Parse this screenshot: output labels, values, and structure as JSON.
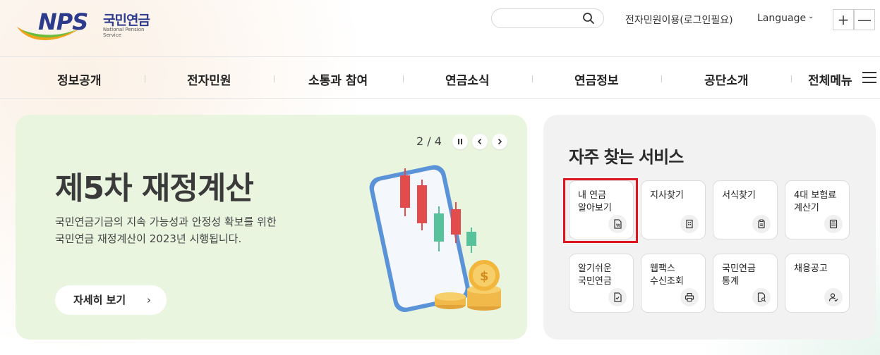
{
  "header": {
    "logo": {
      "brand": "NPS",
      "name_ko": "국민연금",
      "name_en": "National Pension Service"
    },
    "search": {
      "placeholder": ""
    },
    "util_link": "전자민원이용(로그인필요)",
    "language": "Language",
    "zoom_in": "+",
    "zoom_out": "—"
  },
  "nav": {
    "items": [
      "정보공개",
      "전자민원",
      "소통과 참여",
      "연금소식",
      "연금정보",
      "공단소개",
      "전체메뉴"
    ]
  },
  "hero": {
    "pager": "2 / 4",
    "title": "제5차 재정계산",
    "desc_line1": "국민연금기금의 지속 가능성과 안정성 확보를 위한",
    "desc_line2": "국민연금 재정계산이 2023년 시행됩니다.",
    "button": "자세히 보기"
  },
  "services": {
    "title": "자주 찾는 서비스",
    "tiles": [
      {
        "label": "내 연금\n알아보기",
        "icon": "document-won-icon"
      },
      {
        "label": "지사찾기",
        "icon": "building-icon"
      },
      {
        "label": "서식찾기",
        "icon": "clipboard-icon"
      },
      {
        "label": "4대 보험료\n계산기",
        "icon": "calculator-icon"
      },
      {
        "label": "알기쉬운\n국민연금",
        "icon": "document-check-icon"
      },
      {
        "label": "웹팩스\n수신조회",
        "icon": "printer-icon"
      },
      {
        "label": "국민연금\n통계",
        "icon": "document-search-icon"
      },
      {
        "label": "채용공고",
        "icon": "user-check-icon"
      }
    ]
  },
  "colors": {
    "brand_navy": "#2d3b8c",
    "hero_bg": "#eaf5e0",
    "panel_bg": "#f2f2f2",
    "highlight": "#e0141e"
  }
}
